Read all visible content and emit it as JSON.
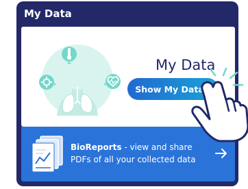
{
  "card": {
    "title": "My Data"
  },
  "panel": {
    "heading": "My Data",
    "button_label": "Show My Data"
  },
  "banner": {
    "title": "BioReports",
    "line1_rest": " - view and share",
    "line2": "PDFs of all your collected data"
  },
  "icons": {
    "illustration": "lungs-health-illustration-icon",
    "thermometer": "thermometer-icon",
    "lungs": "lungs-icon",
    "heart": "heart-pulse-icon",
    "virus": "virus-icon",
    "document": "document-stack-icon",
    "arrow": "arrow-right-icon",
    "hand": "pointing-hand-icon"
  },
  "colors": {
    "card_bg": "#222868",
    "panel_bg": "#ffffff",
    "accent_teal": "#74d7c9",
    "button_gradient_start": "#2169d0",
    "button_gradient_end": "#1aa3d8",
    "banner_bg": "#2a73d9",
    "text_dark": "#222868"
  }
}
